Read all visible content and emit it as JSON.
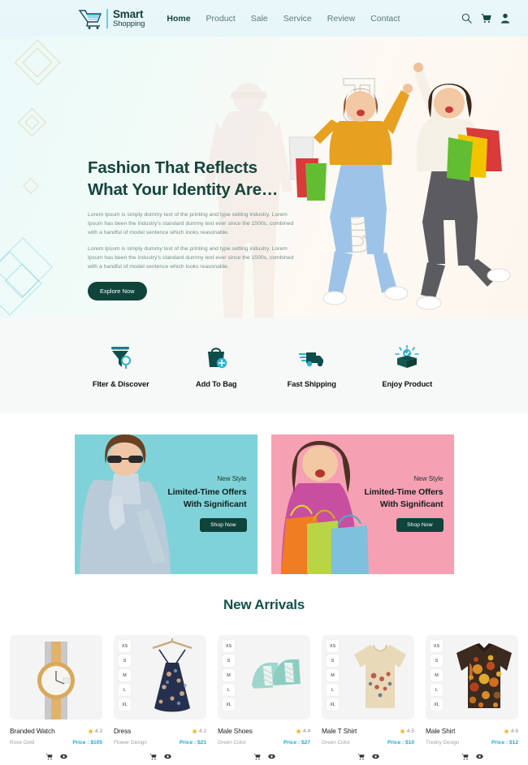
{
  "navbar": {
    "logo": {
      "line1": "Smart",
      "line2": "Shopping",
      "icon": "shopping-cart-logo-icon"
    },
    "links": [
      {
        "label": "Home",
        "active": true
      },
      {
        "label": "Product",
        "active": false
      },
      {
        "label": "Sale",
        "active": false
      },
      {
        "label": "Service",
        "active": false
      },
      {
        "label": "Review",
        "active": false
      },
      {
        "label": "Contact",
        "active": false
      }
    ],
    "icons": [
      "search-icon",
      "cart-icon",
      "user-icon"
    ]
  },
  "hero": {
    "watermark": "Fashion",
    "title_line1": "Fashion That Reflects",
    "title_line2": "What Your Identity Are…",
    "paragraph1": "Lorem Ipsum is simply dummy text of the printing and type setting industry. Lorem Ipsum has been the industry's standard dummy text ever since the 1500s, combined with a handful of model sentence which looks reasonable.",
    "paragraph2": "Lorem Ipsum is simply dummy text of the printing and type setting industry. Lorem Ipsum has been the industry's standard dummy text ever since the 1500s, combined with a handful of model sentence which looks reasonable.",
    "cta_label": "Explore Now"
  },
  "features": [
    {
      "label": "FIter & Discover",
      "icon": "filter-search-icon"
    },
    {
      "label": "Add To Bag",
      "icon": "shopping-bag-plus-icon"
    },
    {
      "label": "Fast Shipping",
      "icon": "delivery-truck-icon"
    },
    {
      "label": "Enjoy Product",
      "icon": "open-box-check-icon"
    }
  ],
  "promos": [
    {
      "eyebrow": "New Style",
      "head_line1": "Limited-Time Offers",
      "head_line2": "With Significant",
      "cta_label": "Shop Now",
      "bg": "#7fd3d8",
      "image": "man-in-denim-jacket-photo"
    },
    {
      "eyebrow": "New Style",
      "head_line1": "Limited-Time Offers",
      "head_line2": "With Significant",
      "cta_label": "Shop Now",
      "bg": "#f6a0b4",
      "image": "woman-with-shopping-bags-photo"
    }
  ],
  "arrivals": {
    "title": "New Arrivals",
    "sizes": [
      "XS",
      "S",
      "M",
      "L",
      "XL"
    ],
    "products": [
      {
        "name": "Branded Watch",
        "rating": "4.3",
        "sub": "Rose Gold",
        "price": "Price : $105",
        "has_sizes": false,
        "art": "wristwatch"
      },
      {
        "name": "Dress",
        "rating": "4.1",
        "sub": "Flower Design",
        "price": "Price : $21",
        "has_sizes": true,
        "art": "dress"
      },
      {
        "name": "Male Shoes",
        "rating": "4.4",
        "sub": "Green Color",
        "price": "Price : $27",
        "has_sizes": true,
        "art": "sneakers"
      },
      {
        "name": "Male T Shirt",
        "rating": "4.5",
        "sub": "Green Color",
        "price": "Price : $10",
        "has_sizes": true,
        "art": "tshirt"
      },
      {
        "name": "Male Shirt",
        "rating": "4.6",
        "sub": "Tredny Design",
        "price": "Price : $12",
        "has_sizes": true,
        "art": "shirt"
      }
    ],
    "card_actions": [
      "add-to-cart-icon",
      "quick-view-icon"
    ]
  },
  "colors": {
    "brand_dark": "#0f443a",
    "accent_blue": "#23a7d4",
    "price_blue": "#23a7d4",
    "star_gold": "#f5b833",
    "nav_bg": "#e9f7fa"
  }
}
